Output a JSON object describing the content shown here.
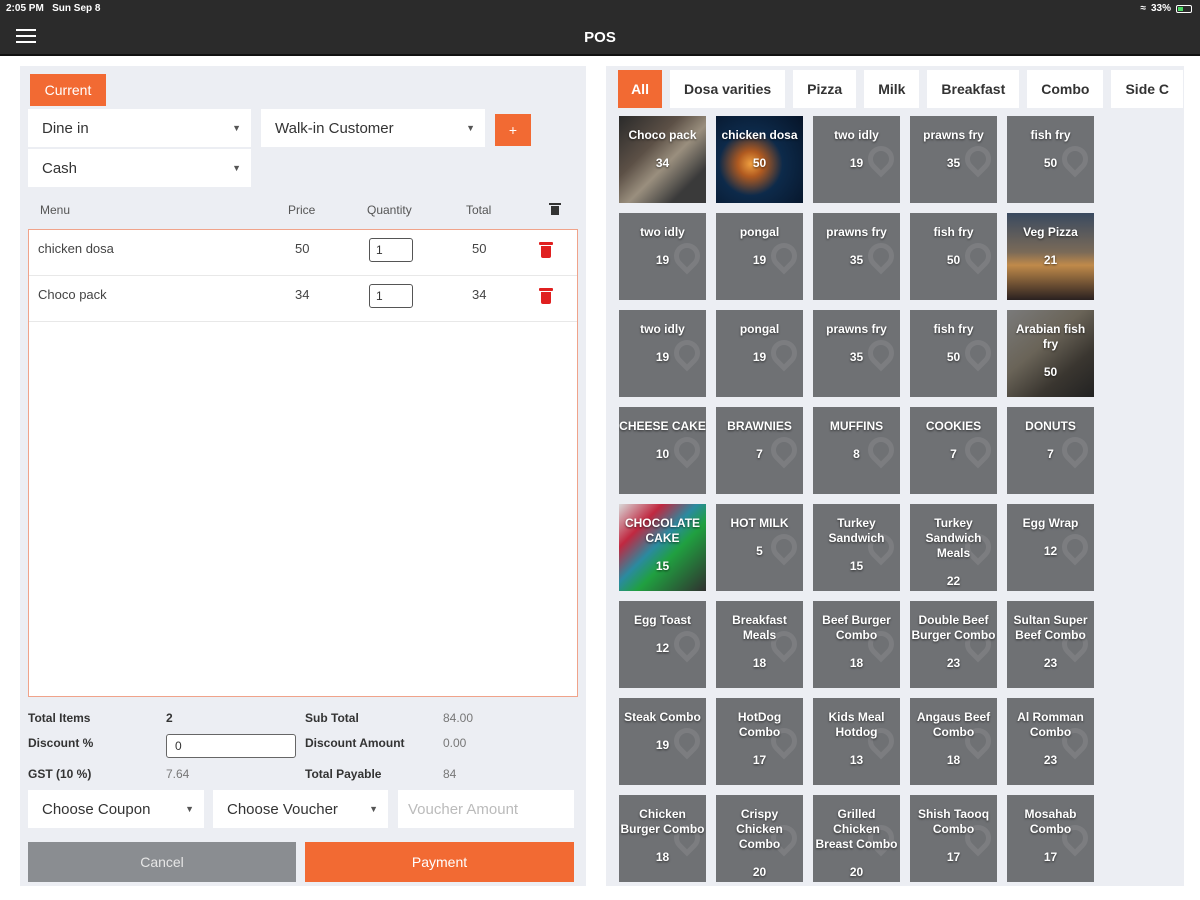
{
  "status": {
    "time": "2:05 PM",
    "date": "Sun Sep 8",
    "battery": "33%"
  },
  "appbar": {
    "title": "POS"
  },
  "order": {
    "tab_current": "Current",
    "order_type": "Dine in",
    "customer": "Walk-in Customer",
    "add_customer": "+",
    "payment_method": "Cash"
  },
  "cart": {
    "headers": {
      "menu": "Menu",
      "price": "Price",
      "quantity": "Quantity",
      "total": "Total"
    },
    "rows": [
      {
        "menu": "chicken dosa",
        "price": "50",
        "quantity": "1",
        "total": "50"
      },
      {
        "menu": "Choco pack",
        "price": "34",
        "quantity": "1",
        "total": "34"
      }
    ]
  },
  "summary": {
    "total_items_label": "Total Items",
    "total_items": "2",
    "sub_total_label": "Sub Total",
    "sub_total": "84.00",
    "discount_pct_label": "Discount %",
    "discount_pct": "0",
    "discount_amount_label": "Discount Amount",
    "discount_amount": "0.00",
    "gst_label": "GST (10 %)",
    "gst": "7.64",
    "total_payable_label": "Total Payable",
    "total_payable": "84"
  },
  "coupon": {
    "coupon": "Choose Coupon",
    "voucher": "Choose Voucher",
    "voucher_amount_placeholder": "Voucher Amount"
  },
  "actions": {
    "cancel": "Cancel",
    "payment": "Payment"
  },
  "categories": [
    "All",
    "Dosa varities",
    "Pizza",
    "Milk",
    "Breakfast",
    "Combo",
    "Side C"
  ],
  "products": [
    {
      "name": "Choco pack",
      "price": "34",
      "img": "img-choco"
    },
    {
      "name": "chicken dosa",
      "price": "50",
      "img": "img-jelly"
    },
    {
      "name": "two idly",
      "price": "19"
    },
    {
      "name": "prawns fry",
      "price": "35"
    },
    {
      "name": "fish fry",
      "price": "50"
    },
    {
      "name": "two idly",
      "price": "19"
    },
    {
      "name": "pongal",
      "price": "19"
    },
    {
      "name": "prawns fry",
      "price": "35"
    },
    {
      "name": "fish fry",
      "price": "50"
    },
    {
      "name": "Veg Pizza",
      "price": "21",
      "img": "img-pizza"
    },
    {
      "name": "two idly",
      "price": "19"
    },
    {
      "name": "pongal",
      "price": "19"
    },
    {
      "name": "prawns fry",
      "price": "35"
    },
    {
      "name": "fish fry",
      "price": "50"
    },
    {
      "name": "Arabian fish fry",
      "price": "50",
      "img": "img-arab"
    },
    {
      "name": "CHEESE CAKE",
      "price": "10"
    },
    {
      "name": "BRAWNIES",
      "price": "7"
    },
    {
      "name": "MUFFINS",
      "price": "8"
    },
    {
      "name": "COOKIES",
      "price": "7"
    },
    {
      "name": "DONUTS",
      "price": "7"
    },
    {
      "name": "CHOCOLATE CAKE",
      "price": "15",
      "img": "img-fly"
    },
    {
      "name": "HOT MILK",
      "price": "5"
    },
    {
      "name": "Turkey Sandwich",
      "price": "15"
    },
    {
      "name": "Turkey Sandwich Meals",
      "price": "22"
    },
    {
      "name": "Egg Wrap",
      "price": "12"
    },
    {
      "name": "Egg Toast",
      "price": "12"
    },
    {
      "name": "Breakfast Meals",
      "price": "18"
    },
    {
      "name": "Beef Burger Combo",
      "price": "18"
    },
    {
      "name": "Double Beef Burger Combo",
      "price": "23"
    },
    {
      "name": "Sultan Super Beef Combo",
      "price": "23"
    },
    {
      "name": "Steak Combo",
      "price": "19"
    },
    {
      "name": "HotDog Combo",
      "price": "17"
    },
    {
      "name": "Kids Meal Hotdog",
      "price": "13"
    },
    {
      "name": "Angaus Beef Combo",
      "price": "18"
    },
    {
      "name": "Al Romman Combo",
      "price": "23"
    },
    {
      "name": "Chicken Burger Combo",
      "price": "18"
    },
    {
      "name": "Crispy Chicken Combo",
      "price": "20"
    },
    {
      "name": "Grilled Chicken Breast Combo",
      "price": "20"
    },
    {
      "name": "Shish Taooq Combo",
      "price": "17"
    },
    {
      "name": "Mosahab Combo",
      "price": "17"
    }
  ]
}
